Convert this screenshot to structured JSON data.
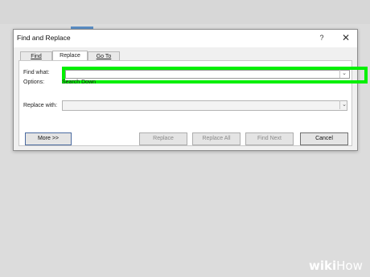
{
  "dialog": {
    "title": "Find and Replace",
    "help": "?",
    "close": "✕",
    "tabs": [
      "Find",
      "Replace",
      "Go To"
    ],
    "active_tab": "Replace",
    "find_label": "Find what:",
    "find_value": "",
    "options_label": "Options:",
    "options_value": "Search Down",
    "replace_label": "Replace with:",
    "replace_value": "",
    "buttons": {
      "more": "More >>",
      "replace": "Replace",
      "replace_all": "Replace All",
      "find_next": "Find Next",
      "cancel": "Cancel"
    }
  },
  "watermark": {
    "wiki": "wiki",
    "how": "How"
  },
  "colors": {
    "highlight": "#00f000"
  }
}
